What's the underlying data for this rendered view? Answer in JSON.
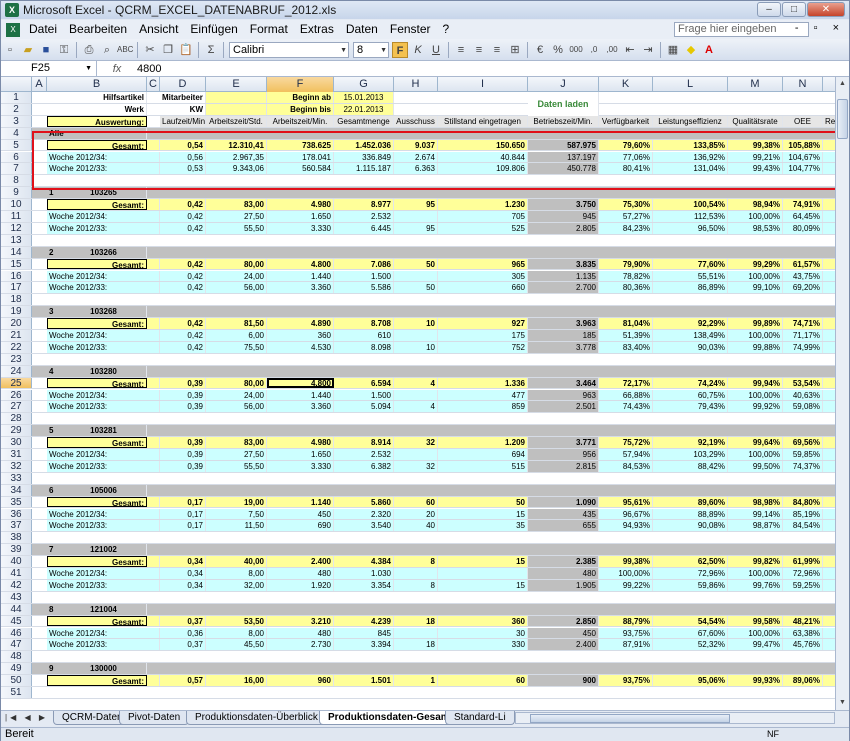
{
  "window": {
    "title": "Microsoft Excel - QCRM_EXCEL_DATENABRUF_2012.xls",
    "app_icon": "excel-icon"
  },
  "menu": [
    "Datei",
    "Bearbeiten",
    "Ansicht",
    "Einfügen",
    "Format",
    "Extras",
    "Daten",
    "Fenster",
    "?"
  ],
  "help": {
    "placeholder": "Frage hier eingeben"
  },
  "toolbar": {
    "font": "Calibri",
    "size": "8"
  },
  "formula": {
    "cell": "F25",
    "fx": "fx",
    "value": "4800"
  },
  "columns": [
    "A",
    "B",
    "C",
    "D",
    "E",
    "F",
    "G",
    "H",
    "I",
    "J",
    "K",
    "L",
    "M",
    "N"
  ],
  "selected_column": "F",
  "header": {
    "hilfsartikel": "Hilfsartikel",
    "werk": "Werk",
    "auswertung": "Auswertung:",
    "mitarbeiter": "Mitarbeiter",
    "kw": "KW",
    "beginn_ab": "Beginn ab",
    "beginn_ab_val": "15.01.2013",
    "beginn_bis": "Beginn bis",
    "beginn_bis_val": "22.01.2013",
    "daten_laden": "Daten laden",
    "cols": [
      "Laufzeit/Min.",
      "Arbeitszeit/Std.",
      "Arbeitszeit/Min.",
      "Gesamtmenge",
      "Ausschuss",
      "Stillstand eingetragen",
      "Betriebszeit/Min.",
      "Verfügbarkeit",
      "Leistungseffizienz",
      "Qualitätsrate",
      "OEE",
      "Re"
    ]
  },
  "alle": {
    "label": "Alle",
    "rows": [
      {
        "label": "Gesamt:",
        "vals": [
          "0,54",
          "12.310,41",
          "738.625",
          "1.452.036",
          "9.037",
          "150.650",
          "587.975",
          "79,60%",
          "133,85%",
          "99,38%",
          "105,88%"
        ]
      },
      {
        "label": "Woche 2012/34:",
        "vals": [
          "0,56",
          "2.967,35",
          "178.041",
          "336.849",
          "2.674",
          "40.844",
          "137.197",
          "77,06%",
          "136,92%",
          "99,21%",
          "104,67%"
        ]
      },
      {
        "label": "Woche 2012/33:",
        "vals": [
          "0,53",
          "9.343,06",
          "560.584",
          "1.115.187",
          "6.363",
          "109.806",
          "450.778",
          "80,41%",
          "131,04%",
          "99,43%",
          "104,77%"
        ]
      }
    ]
  },
  "groups": [
    {
      "num": "1",
      "id": "103265",
      "rows": [
        {
          "label": "Gesamt:",
          "vals": [
            "0,42",
            "83,00",
            "4.980",
            "8.977",
            "95",
            "1.230",
            "3.750",
            "75,30%",
            "100,54%",
            "98,94%",
            "74,91%"
          ]
        },
        {
          "label": "Woche 2012/34:",
          "vals": [
            "0,42",
            "27,50",
            "1.650",
            "2.532",
            "",
            "705",
            "945",
            "57,27%",
            "112,53%",
            "100,00%",
            "64,45%"
          ]
        },
        {
          "label": "Woche 2012/33:",
          "vals": [
            "0,42",
            "55,50",
            "3.330",
            "6.445",
            "95",
            "525",
            "2.805",
            "84,23%",
            "96,50%",
            "98,53%",
            "80,09%"
          ]
        }
      ]
    },
    {
      "num": "2",
      "id": "103266",
      "rows": [
        {
          "label": "Gesamt:",
          "vals": [
            "0,42",
            "80,00",
            "4.800",
            "7.086",
            "50",
            "965",
            "3.835",
            "79,90%",
            "77,60%",
            "99,29%",
            "61,57%"
          ]
        },
        {
          "label": "Woche 2012/34:",
          "vals": [
            "0,42",
            "24,00",
            "1.440",
            "1.500",
            "",
            "305",
            "1.135",
            "78,82%",
            "55,51%",
            "100,00%",
            "43,75%"
          ]
        },
        {
          "label": "Woche 2012/33:",
          "vals": [
            "0,42",
            "56,00",
            "3.360",
            "5.586",
            "50",
            "660",
            "2.700",
            "80,36%",
            "86,89%",
            "99,10%",
            "69,20%"
          ]
        }
      ]
    },
    {
      "num": "3",
      "id": "103268",
      "rows": [
        {
          "label": "Gesamt:",
          "vals": [
            "0,42",
            "81,50",
            "4.890",
            "8.708",
            "10",
            "927",
            "3.963",
            "81,04%",
            "92,29%",
            "99,89%",
            "74,71%"
          ]
        },
        {
          "label": "Woche 2012/34:",
          "vals": [
            "0,42",
            "6,00",
            "360",
            "610",
            "",
            "175",
            "185",
            "51,39%",
            "138,49%",
            "100,00%",
            "71,17%"
          ]
        },
        {
          "label": "Woche 2012/33:",
          "vals": [
            "0,42",
            "75,50",
            "4.530",
            "8.098",
            "10",
            "752",
            "3.778",
            "83,40%",
            "90,03%",
            "99,88%",
            "74,99%"
          ]
        }
      ]
    },
    {
      "num": "4",
      "id": "103280",
      "rows": [
        {
          "label": "Gesamt:",
          "vals": [
            "0,39",
            "80,00",
            "4.800",
            "6.594",
            "4",
            "1.336",
            "3.464",
            "72,17%",
            "74,24%",
            "99,94%",
            "53,54%"
          ]
        },
        {
          "label": "Woche 2012/34:",
          "vals": [
            "0,39",
            "24,00",
            "1.440",
            "1.500",
            "",
            "477",
            "963",
            "66,88%",
            "60,75%",
            "100,00%",
            "40,63%"
          ]
        },
        {
          "label": "Woche 2012/33:",
          "vals": [
            "0,39",
            "56,00",
            "3.360",
            "5.094",
            "4",
            "859",
            "2.501",
            "74,43%",
            "79,43%",
            "99,92%",
            "59,08%"
          ]
        }
      ]
    },
    {
      "num": "5",
      "id": "103281",
      "rows": [
        {
          "label": "Gesamt:",
          "vals": [
            "0,39",
            "83,00",
            "4.980",
            "8.914",
            "32",
            "1.209",
            "3.771",
            "75,72%",
            "92,19%",
            "99,64%",
            "69,56%"
          ]
        },
        {
          "label": "Woche 2012/34:",
          "vals": [
            "0,39",
            "27,50",
            "1.650",
            "2.532",
            "",
            "694",
            "956",
            "57,94%",
            "103,29%",
            "100,00%",
            "59,85%"
          ]
        },
        {
          "label": "Woche 2012/33:",
          "vals": [
            "0,39",
            "55,50",
            "3.330",
            "6.382",
            "32",
            "515",
            "2.815",
            "84,53%",
            "88,42%",
            "99,50%",
            "74,37%"
          ]
        }
      ]
    },
    {
      "num": "6",
      "id": "105006",
      "rows": [
        {
          "label": "Gesamt:",
          "vals": [
            "0,17",
            "19,00",
            "1.140",
            "5.860",
            "60",
            "50",
            "1.090",
            "95,61%",
            "89,60%",
            "98,98%",
            "84,80%"
          ]
        },
        {
          "label": "Woche 2012/34:",
          "vals": [
            "0,17",
            "7,50",
            "450",
            "2.320",
            "20",
            "15",
            "435",
            "96,67%",
            "88,89%",
            "99,14%",
            "85,19%"
          ]
        },
        {
          "label": "Woche 2012/33:",
          "vals": [
            "0,17",
            "11,50",
            "690",
            "3.540",
            "40",
            "35",
            "655",
            "94,93%",
            "90,08%",
            "98,87%",
            "84,54%"
          ]
        }
      ]
    },
    {
      "num": "7",
      "id": "121002",
      "rows": [
        {
          "label": "Gesamt:",
          "vals": [
            "0,34",
            "40,00",
            "2.400",
            "4.384",
            "8",
            "15",
            "2.385",
            "99,38%",
            "62,50%",
            "99,82%",
            "61,99%"
          ]
        },
        {
          "label": "Woche 2012/34:",
          "vals": [
            "0,34",
            "8,00",
            "480",
            "1.030",
            "",
            "",
            "480",
            "100,00%",
            "72,96%",
            "100,00%",
            "72,96%"
          ]
        },
        {
          "label": "Woche 2012/33:",
          "vals": [
            "0,34",
            "32,00",
            "1.920",
            "3.354",
            "8",
            "15",
            "1.905",
            "99,22%",
            "59,86%",
            "99,76%",
            "59,25%"
          ]
        }
      ]
    },
    {
      "num": "8",
      "id": "121004",
      "rows": [
        {
          "label": "Gesamt:",
          "vals": [
            "0,37",
            "53,50",
            "3.210",
            "4.239",
            "18",
            "360",
            "2.850",
            "88,79%",
            "54,54%",
            "99,58%",
            "48,21%"
          ]
        },
        {
          "label": "Woche 2012/34:",
          "vals": [
            "0,36",
            "8,00",
            "480",
            "845",
            "",
            "30",
            "450",
            "93,75%",
            "67,60%",
            "100,00%",
            "63,38%"
          ]
        },
        {
          "label": "Woche 2012/33:",
          "vals": [
            "0,37",
            "45,50",
            "2.730",
            "3.394",
            "18",
            "330",
            "2.400",
            "87,91%",
            "52,32%",
            "99,47%",
            "45,76%"
          ]
        }
      ]
    },
    {
      "num": "9",
      "id": "130000",
      "rows": [
        {
          "label": "Gesamt:",
          "vals": [
            "0,57",
            "16,00",
            "960",
            "1.501",
            "1",
            "60",
            "900",
            "93,75%",
            "95,06%",
            "99,93%",
            "89,06%"
          ]
        }
      ]
    }
  ],
  "row_numbers": [
    "1",
    "2",
    "3",
    "4",
    "5",
    "6",
    "7",
    "8",
    "9",
    "10",
    "11",
    "12",
    "13",
    "14",
    "15",
    "16",
    "17",
    "18",
    "19",
    "20",
    "21",
    "22",
    "23",
    "24",
    "25",
    "26",
    "27",
    "28",
    "29",
    "30",
    "31",
    "32",
    "33",
    "34",
    "35",
    "36",
    "37",
    "38",
    "39",
    "40",
    "41",
    "42",
    "43",
    "44",
    "45",
    "46",
    "47",
    "48",
    "49",
    "50",
    "51"
  ],
  "selected_row": "25",
  "tabs": [
    "QCRM-Daten",
    "Pivot-Daten",
    "Produktionsdaten-Überblick",
    "Produktionsdaten-Gesamt",
    "Standard-Li"
  ],
  "active_tab": "Produktionsdaten-Gesamt",
  "status": {
    "text": "Bereit",
    "nf": "NF"
  }
}
